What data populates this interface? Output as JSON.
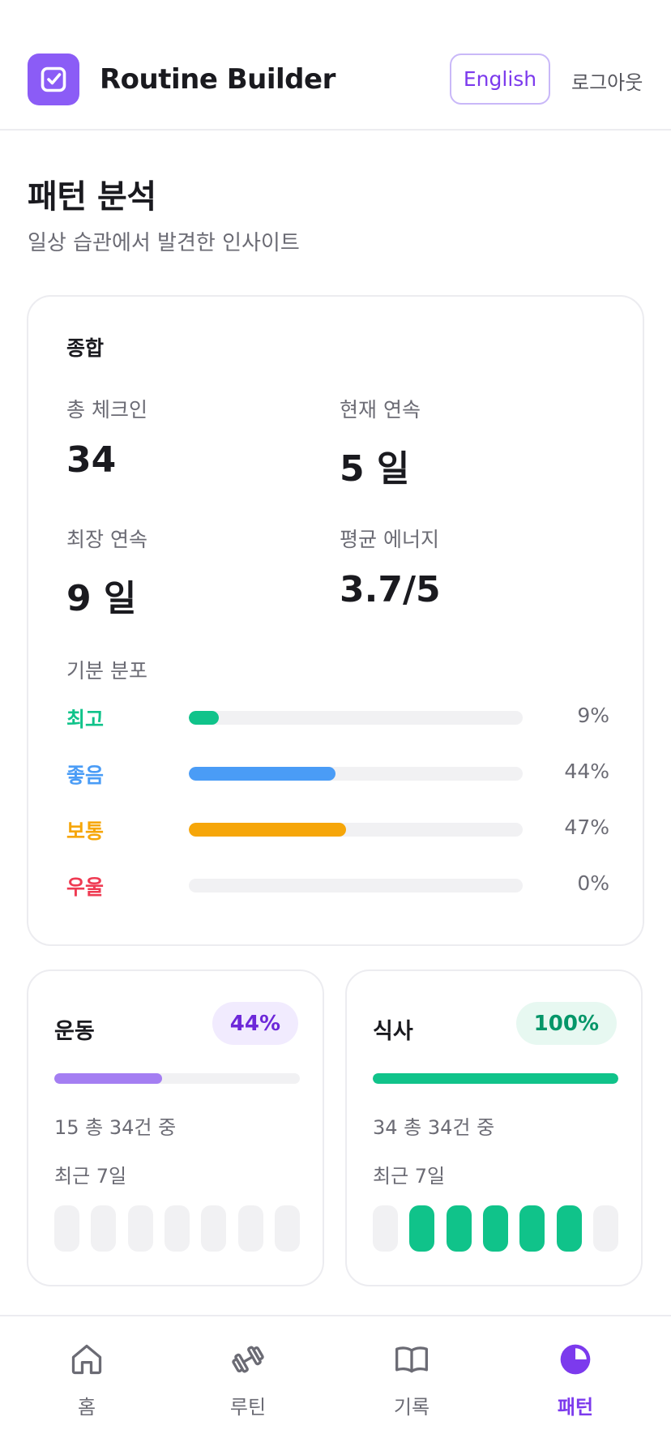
{
  "header": {
    "app_title": "Routine Builder",
    "language_button": "English",
    "logout": "로그아웃",
    "logo_icon": "checkbox-icon",
    "accent": "#8b5cf6"
  },
  "page": {
    "title": "패턴 분석",
    "subtitle": "일상 습관에서 발견한 인사이트"
  },
  "summary": {
    "heading": "종합",
    "stats": [
      {
        "label": "총 체크인",
        "value": "34"
      },
      {
        "label": "현재 연속",
        "value": "5 일"
      },
      {
        "label": "최장 연속",
        "value": "9 일"
      },
      {
        "label": "평균 에너지",
        "value": "3.7/5"
      }
    ],
    "mood_heading": "기분 분포",
    "moods": [
      {
        "name": "최고",
        "percent": 9,
        "percent_label": "9%",
        "color": "#10c38a"
      },
      {
        "name": "좋음",
        "percent": 44,
        "percent_label": "44%",
        "color": "#4a9cf6"
      },
      {
        "name": "보통",
        "percent": 47,
        "percent_label": "47%",
        "color": "#f6a609"
      },
      {
        "name": "우울",
        "percent": 0,
        "percent_label": "0%",
        "color": "#ef3a52"
      }
    ]
  },
  "habits": [
    {
      "title": "운동",
      "badge": "44%",
      "percent": 44,
      "count_text": "15 총 34건 중",
      "recent_label": "최근 7일",
      "badge_color": "#6d28d9",
      "badge_bg": "#f1ebfe",
      "fill_color": "#a47ef2",
      "days": [
        false,
        false,
        false,
        false,
        false,
        false,
        false
      ]
    },
    {
      "title": "식사",
      "badge": "100%",
      "percent": 100,
      "count_text": "34 총 34건 중",
      "recent_label": "최근 7일",
      "badge_color": "#059669",
      "badge_bg": "#e7f8f1",
      "fill_color": "#10c38a",
      "days": [
        false,
        true,
        true,
        true,
        true,
        true,
        false
      ]
    }
  ],
  "nav": {
    "items": [
      {
        "label": "홈",
        "icon": "home-icon",
        "active": false
      },
      {
        "label": "루틴",
        "icon": "dumbbell-icon",
        "active": false
      },
      {
        "label": "기록",
        "icon": "book-icon",
        "active": false
      },
      {
        "label": "패턴",
        "icon": "pie-chart-icon",
        "active": true
      }
    ],
    "active_color": "#7c3aed",
    "inactive_color": "#6b6b74"
  }
}
